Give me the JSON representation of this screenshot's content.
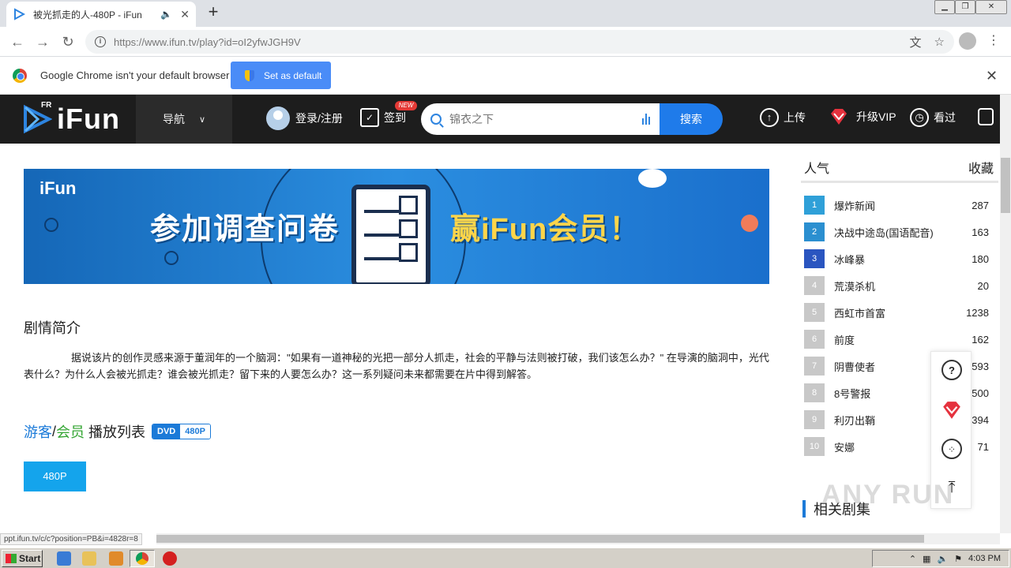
{
  "browser": {
    "tab_title": "被光抓走的人-480P - iFun",
    "url_host": "https://www.ifun.tv",
    "url_path": "/play?id=oI2yfwJGH9V",
    "new_tab": "+",
    "infobar_text": "Google Chrome isn't your default browser",
    "set_default_label": "Set as default"
  },
  "site": {
    "logo_text": "iFun",
    "logo_badge": "FR",
    "nav_label": "导航",
    "login_label": "登录/注册",
    "checkin_label": "签到",
    "new_badge": "NEW",
    "search_placeholder": "锦衣之下",
    "search_button": "搜索",
    "upload_label": "上传",
    "vip_label": "升级VIP",
    "history_label": "看过"
  },
  "banner": {
    "logo": "iFun",
    "text_left": "参加调查问卷",
    "text_right": "赢iFun会员！"
  },
  "synopsis": {
    "title": "剧情简介",
    "text": "据说该片的创作灵感来源于董润年的一个脑洞：\"如果有一道神秘的光把一部分人抓走，社会的平静与法则被打破，我们该怎么办？\" 在导演的脑洞中，光代表什么？为什么人会被光抓走？谁会被光抓走？留下来的人要怎么办？这一系列疑问未来都需要在片中得到解答。"
  },
  "playlist": {
    "guest": "游客",
    "slash": "/",
    "member": "会员",
    "label": " 播放列表",
    "badge_dvd": "DVD",
    "badge_res": "480P",
    "episodes": [
      "480P"
    ]
  },
  "ranking": {
    "tab_popular": "人气",
    "tab_favorite": "收藏",
    "items": [
      {
        "rank": "1",
        "name": "爆炸新闻",
        "count": "287",
        "color": "#2fa0d8"
      },
      {
        "rank": "2",
        "name": "决战中途岛(国语配音)",
        "count": "163",
        "color": "#2b8fd0"
      },
      {
        "rank": "3",
        "name": "冰峰暴",
        "count": "180",
        "color": "#2a55c0"
      },
      {
        "rank": "4",
        "name": "荒漠杀机",
        "count": "20",
        "color": "#c8c8c8"
      },
      {
        "rank": "5",
        "name": "西虹市首富",
        "count": "1238",
        "color": "#c8c8c8"
      },
      {
        "rank": "6",
        "name": "前度",
        "count": "162",
        "color": "#c8c8c8"
      },
      {
        "rank": "7",
        "name": "阴曹使者",
        "count": "593",
        "color": "#c8c8c8"
      },
      {
        "rank": "8",
        "name": "8号警报",
        "count": "500",
        "color": "#c8c8c8"
      },
      {
        "rank": "9",
        "name": "利刃出鞘",
        "count": "394",
        "color": "#c8c8c8"
      },
      {
        "rank": "10",
        "name": "安娜",
        "count": "71",
        "color": "#c8c8c8"
      }
    ],
    "related_title": "相关剧集"
  },
  "status_url": "ppt.ifun.tv/c/c?position=PB&i=4828r=8",
  "taskbar": {
    "start_label": "Start",
    "clock": "4:03 PM"
  },
  "watermark": "ANY RUN"
}
